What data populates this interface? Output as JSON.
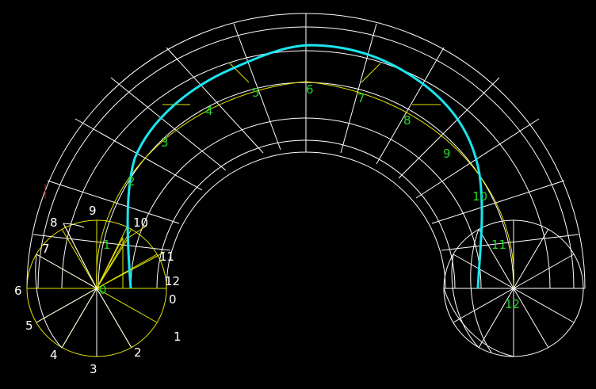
{
  "colors": {
    "background": "#000000",
    "grid_lines": "#ffffff",
    "construction_lines": "#e6e600",
    "helix_curve": "#19e6f0",
    "green_labels": "#22d822",
    "white_labels": "#ffffff",
    "marker": "#cc2222"
  },
  "left_circle_labels": {
    "d0": "0",
    "d1": "1",
    "d2": "2",
    "d3": "3",
    "d4": "4",
    "d5": "5",
    "d6": "6",
    "d7": "7",
    "d8": "8",
    "d9": "9",
    "d10": "10",
    "d11": "11",
    "d12": "12"
  },
  "helix_labels": {
    "h0": "0",
    "h1": "1",
    "h2": "2",
    "h3": "3",
    "h4": "4",
    "h5": "5",
    "h6": "6",
    "h7": "7",
    "h8": "8",
    "h9": "9",
    "h10": "10",
    "h11": "11",
    "h12": "12"
  }
}
